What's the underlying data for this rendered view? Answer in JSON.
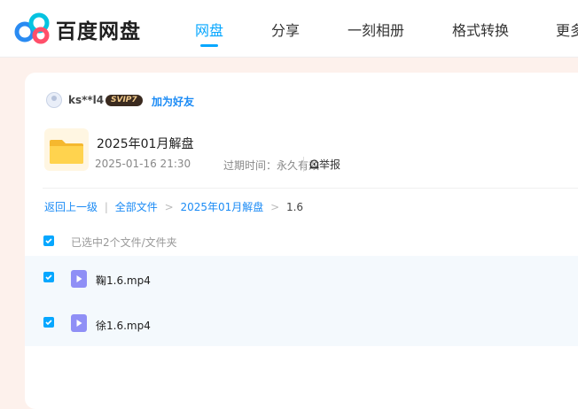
{
  "header": {
    "brand": "百度网盘",
    "nav": [
      {
        "label": "网盘",
        "active": true
      },
      {
        "label": "分享",
        "active": false
      },
      {
        "label": "一刻相册",
        "active": false
      },
      {
        "label": "格式转换",
        "active": false
      },
      {
        "label": "更多",
        "active": false
      }
    ]
  },
  "sharer": {
    "username": "ks**l4",
    "vip_badge": "SVIP7",
    "add_friend_label": "加为好友"
  },
  "share": {
    "title": "2025年01月解盘",
    "datetime": "2025-01-16 21:30",
    "expire_label": "过期时间：永久有效",
    "report_label": "举报"
  },
  "breadcrumb": {
    "back": "返回上一级",
    "separator": "|",
    "all_files": "全部文件",
    "arrow": ">",
    "folder": "2025年01月解盘",
    "current": "1.6"
  },
  "selection": {
    "text": "已选中2个文件/文件夹"
  },
  "files": [
    {
      "name": "鞠1.6.mp4",
      "checked": true,
      "icon": "video-file-icon"
    },
    {
      "name": "徐1.6.mp4",
      "checked": true,
      "icon": "video-file-icon"
    }
  ],
  "colors": {
    "accent": "#06a7ff",
    "link": "#1b8bf5",
    "page_bg": "#fdf1ec",
    "file_icon": "#8f8ff6"
  }
}
